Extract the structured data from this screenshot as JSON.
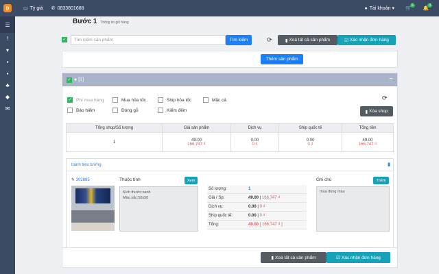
{
  "topbar": {
    "rate_label": "Tỷ giá",
    "phone": "0833801688",
    "account_label": "Tài khoản",
    "cart_badge": "0",
    "notif_badge": "0"
  },
  "header": {
    "step": "Bước 1",
    "step_sub": "Thông tin giỏ hàng"
  },
  "search": {
    "placeholder": "Tìm kiếm sản phẩm",
    "button": "Tìm kiếm"
  },
  "actions": {
    "clear_all": "Xoá tất cả sản phẩm",
    "confirm": "Xác nhận đơn hàng",
    "add_product": "Thêm sản phẩm"
  },
  "shop": {
    "title": "[1]",
    "options": [
      {
        "label": "Phí mua hàng",
        "checked": true
      },
      {
        "label": "Mua hỏa tốc",
        "checked": false
      },
      {
        "label": "Ship hỏa tốc",
        "checked": false
      },
      {
        "label": "Mặc cả",
        "checked": false
      },
      {
        "label": "Bảo hiểm",
        "checked": false
      },
      {
        "label": "Đóng gỗ",
        "checked": false
      },
      {
        "label": "Kiểm đếm",
        "checked": false
      }
    ],
    "delete_shop": "Xóa shop",
    "summary_headers": [
      "Tổng shop/Số lượng",
      "Giá sản phẩm",
      "Dịch vụ",
      "Ship quốc tế",
      "Tổng tiền"
    ],
    "summary": {
      "qty": "1",
      "price": "49.00",
      "price_vnd": "166,747 ₫",
      "service": "0.00",
      "service_vnd": "0 ₫",
      "ship": "0.00",
      "ship_vnd": "0 ₫",
      "total": "49.00",
      "total_vnd": "166,747 ₫"
    }
  },
  "product": {
    "name": "tranh treo tường",
    "id": "302885",
    "attr_label": "Thuộc tính",
    "attr_btn": "Xem",
    "attr_text_1": "Kích thước:xanh",
    "attr_text_2": "Màu sắc:50x50",
    "qty_label": "Số lượng:",
    "qty": "1",
    "price_label": "Giá / Sp:",
    "price": "49.00",
    "price_vnd": "166,747 ₫",
    "service_label": "Dịch vụ:",
    "service": "0.00",
    "service_vnd": "0 ₫",
    "ship_label": "Ship quốc tế:",
    "ship": "0.00",
    "ship_vnd": "0 ₫",
    "total_label": "Tổng:",
    "total": "49.00",
    "total_vnd": "166,747 ₫",
    "note_label": "Ghi chú",
    "note_btn": "Thêm",
    "note_text": "mua đúng màu"
  },
  "colors": {
    "accent": "#1e80f7",
    "sidebar": "#3c4b64",
    "success": "#2eb85c",
    "teal": "#17a2b8",
    "grey_button": "#555b63",
    "shop_header": "#a9b3c9",
    "price_red": "#e55353"
  }
}
